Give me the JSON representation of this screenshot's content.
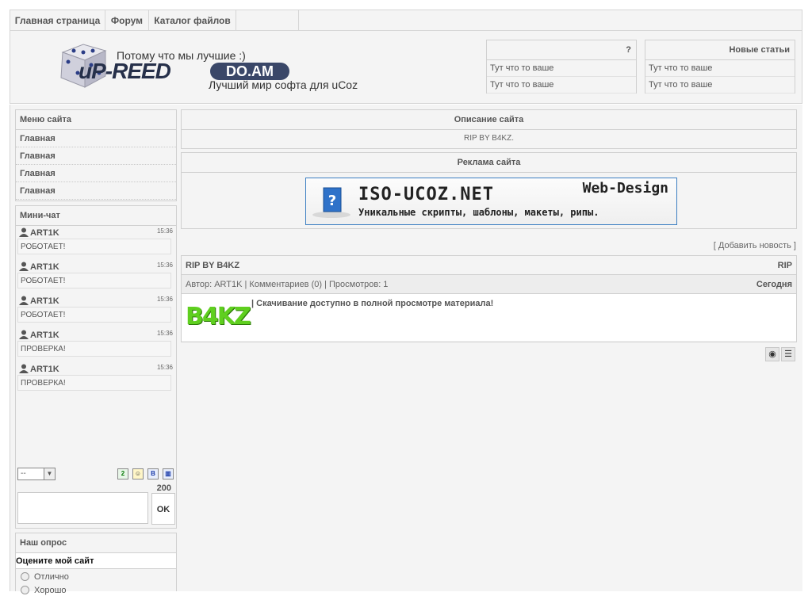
{
  "nav": {
    "items": [
      "Главная страница",
      "Форум",
      "Каталог файлов"
    ]
  },
  "header": {
    "logo_up": "uP-REED",
    "logo_domain": "DO.AM",
    "slogan_top": "Потому что мы лучшие :)",
    "slogan_bottom": "Лучший мир софта для uCoz",
    "box1": {
      "title": "?",
      "rows": [
        "Тут что то ваше",
        "Тут что то ваше"
      ]
    },
    "box2": {
      "title": "Новые статьи",
      "rows": [
        "Тут что то ваше",
        "Тут что то ваше"
      ]
    }
  },
  "sidebar": {
    "menu_title": "Меню сайта",
    "menu_items": [
      "Главная",
      "Главная",
      "Главная",
      "Главная"
    ],
    "chat_title": "Мини-чат",
    "chat_messages": [
      {
        "user": "ART1K",
        "time": "15:36",
        "text": "РОБОТАЕТ!"
      },
      {
        "user": "ART1K",
        "time": "15:36",
        "text": "РОБОТАЕТ!"
      },
      {
        "user": "ART1K",
        "time": "15:36",
        "text": "РОБОТАЕТ!"
      },
      {
        "user": "ART1K",
        "time": "15:36",
        "text": "ПРОВЕРКА!"
      },
      {
        "user": "ART1K",
        "time": "15:36",
        "text": "ПРОВЕРКА!"
      }
    ],
    "chat_select": "--",
    "chat_counter": "200",
    "chat_ok": "OK",
    "poll_title": "Наш опрос",
    "poll_question": "Оцените мой сайт",
    "poll_options": [
      "Отлично",
      "Хорошо"
    ]
  },
  "main": {
    "desc_title": "Описание сайта",
    "desc_text": "RIP BY B4KZ.",
    "ads_title": "Реклама сайта",
    "banner_domain": "ISO-UCOZ.NET",
    "banner_brand": "Web-Design",
    "banner_slogan": "Уникальные скрипты, шаблоны, макеты, рипы.",
    "add_news": "[ Добавить новость ]",
    "post": {
      "title": "RIP BY B4KZ",
      "category": "RIP",
      "meta": "Автор: ART1K | Комментариев (0) | Просмотров: 1",
      "date": "Сегодня",
      "logo_text": "B4KZ",
      "text": "| Скачивание доступно в полной просмотре материала!"
    }
  },
  "colors": {
    "banner_border": "#3c7fc2",
    "logo_green": "#5fcf1f",
    "logo_dark": "#26304a"
  }
}
